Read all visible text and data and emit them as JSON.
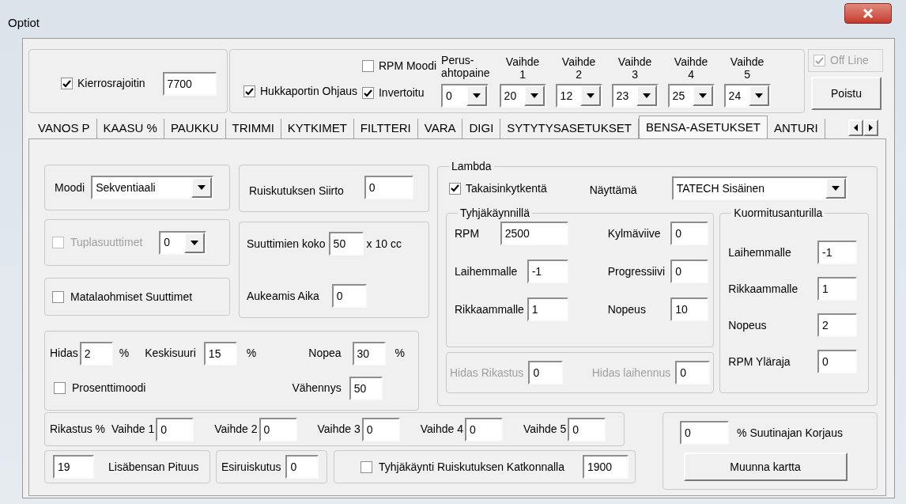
{
  "window": {
    "title": "Optiot"
  },
  "top": {
    "rev_limiter": {
      "label": "Kierrosrajoitin",
      "checked": true,
      "value": "7700"
    },
    "wastegate": {
      "label": "Hukkaportin Ohjaus",
      "checked": true
    },
    "rpm_mode": {
      "label": "RPM Moodi",
      "checked": false
    },
    "inverted": {
      "label": "Invertoitu",
      "checked": true
    },
    "base_pressure": {
      "label": "Perus-\nahtopaine",
      "value": "0"
    },
    "gears": [
      {
        "label": "Vaihde\n1",
        "value": "20"
      },
      {
        "label": "Vaihde\n2",
        "value": "12"
      },
      {
        "label": "Vaihde\n3",
        "value": "23"
      },
      {
        "label": "Vaihde\n4",
        "value": "25"
      },
      {
        "label": "Vaihde\n5",
        "value": "24"
      }
    ],
    "offline": {
      "label": "Off Line",
      "checked": true,
      "disabled": true
    },
    "exit_button": "Poistu"
  },
  "tabs": [
    {
      "label": "VANOS P",
      "selected": false
    },
    {
      "label": "KAASU %",
      "selected": false
    },
    {
      "label": "PAUKKU",
      "selected": false
    },
    {
      "label": "TRIMMI",
      "selected": false
    },
    {
      "label": "KYTKIMET",
      "selected": false
    },
    {
      "label": "FILTTERI",
      "selected": false
    },
    {
      "label": "VARA",
      "selected": false
    },
    {
      "label": "DIGI",
      "selected": false
    },
    {
      "label": "SYTYTYSASETUKSET",
      "selected": false
    },
    {
      "label": "BENSA-ASETUKSET",
      "selected": true
    },
    {
      "label": "ANTURI",
      "selected": false
    }
  ],
  "mode": {
    "label": "Moodi",
    "value": "Sekventiaali"
  },
  "injection_shift": {
    "label": "Ruiskutuksen Siirto",
    "value": "0"
  },
  "dual_injectors": {
    "label": "Tuplasuuttimet",
    "checked": false,
    "disabled": true,
    "value": "0"
  },
  "injector_size": {
    "label": "Suuttimien koko",
    "value": "50",
    "unit": "x 10 cc"
  },
  "opening_time": {
    "label": "Aukeamis Aika",
    "value": "0"
  },
  "low_impedance": {
    "label": "Matalaohmiset Suuttimet",
    "checked": false
  },
  "speeds": {
    "slow": {
      "label": "Hidas",
      "value": "2",
      "unit": "%"
    },
    "medium": {
      "label": "Keskisuuri",
      "value": "15",
      "unit": "%"
    },
    "fast": {
      "label": "Nopea",
      "value": "30",
      "unit": "%"
    },
    "percent_mode": {
      "label": "Prosenttimoodi",
      "checked": false
    },
    "reduction": {
      "label": "Vähennys",
      "value": "50"
    }
  },
  "lambda": {
    "title": "Lambda",
    "feedback": {
      "label": "Takaisinkytkentä",
      "checked": true
    },
    "display": {
      "label": "Näyttämä",
      "value": "TATECH Sisäinen"
    },
    "idle": {
      "title": "Tyhjäkäynnillä",
      "fields": [
        {
          "label": "RPM",
          "value": "2500"
        },
        {
          "label": "Kylmäviive",
          "value": "0"
        },
        {
          "label": "Laihemmalle",
          "value": "-1"
        },
        {
          "label": "Progressiivi",
          "value": "0"
        },
        {
          "label": "Rikkaammalle",
          "value": "1"
        },
        {
          "label": "Nopeus",
          "value": "10"
        }
      ]
    },
    "slow": {
      "disabled": true,
      "fields": [
        {
          "label": "Hidas Rikastus",
          "value": "0"
        },
        {
          "label": "Hidas laihennus",
          "value": "0"
        }
      ]
    },
    "load": {
      "title": "Kuormitusanturilla",
      "fields": [
        {
          "label": "Laihemmalle",
          "value": "-1"
        },
        {
          "label": "Rikkaammalle",
          "value": "1"
        },
        {
          "label": "Nopeus",
          "value": "2"
        },
        {
          "label": "RPM Yläraja",
          "value": "0"
        }
      ]
    }
  },
  "enrichment": {
    "label": "Rikastus %",
    "gears": [
      {
        "label": "Vaihde 1",
        "value": "0"
      },
      {
        "label": "Vaihde 2",
        "value": "0"
      },
      {
        "label": "Vaihde 3",
        "value": "0"
      },
      {
        "label": "Vaihde 4",
        "value": "0"
      },
      {
        "label": "Vaihde 5",
        "value": "0"
      }
    ]
  },
  "correction": {
    "value": "0",
    "label": "% Suutinajan Korjaus",
    "button": "Muunna kartta"
  },
  "extra_fuel": {
    "value": "19",
    "label": "Lisäbensan Pituus"
  },
  "pre_injection": {
    "label": "Esiruiskutus",
    "value": "0"
  },
  "idle_cut": {
    "label": "Tyhjäkäynti Ruiskutuksen Katkonnalla",
    "checked": false,
    "value": "1900"
  }
}
